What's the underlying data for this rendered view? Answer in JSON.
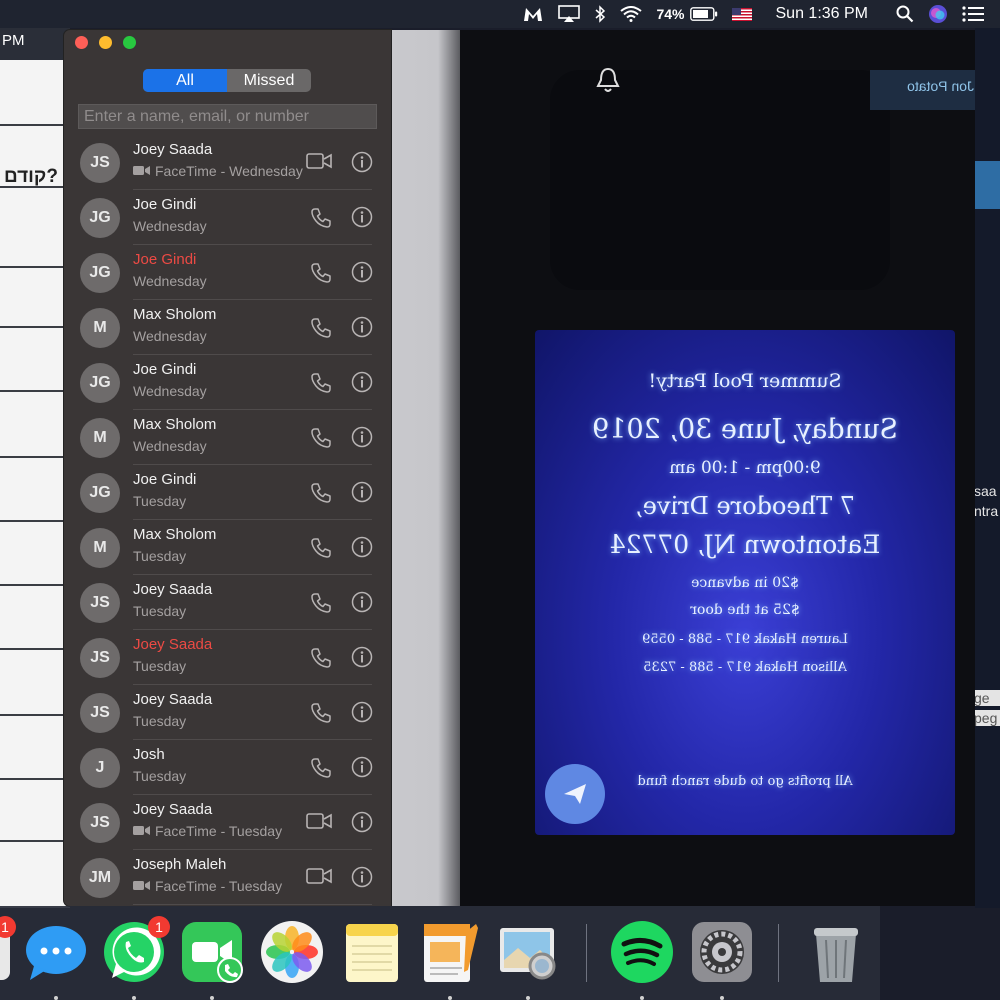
{
  "menubar": {
    "battery_percent": "74%",
    "clock": "Sun 1:36 PM",
    "icons": [
      "malwarebytes-icon",
      "airplay-icon",
      "bluetooth-icon",
      "wifi-icon",
      "battery-icon",
      "us-flag-icon",
      "spotlight-search-icon",
      "siri-icon",
      "notification-center-icon"
    ]
  },
  "background": {
    "left_window_time": "PM",
    "left_window_hebrew": "קודם?",
    "right_text_1": "saa",
    "right_text_2": "ntra",
    "right_text_3": "ge",
    "right_text_4": "peg"
  },
  "video": {
    "top_right_label": "Jon Potato",
    "card_lines": [
      "Summer Pool Party!",
      "Sunday, June 30, 2019",
      "9:00pm - 1:00 am",
      "7 Theodore Drive,",
      "Eatontown NJ, 07724",
      "$20 in advance",
      "$25 at the door",
      "Lauren Hakak 917 - 588 - 0559",
      "Allison Hakak 917 - 588 - 7235",
      "All profits go to dude ranch fund"
    ]
  },
  "facetime": {
    "tabs": [
      {
        "label": "All",
        "active": true
      },
      {
        "label": "Missed",
        "active": false
      }
    ],
    "search_placeholder": "Enter a name, email, or number",
    "calls": [
      {
        "initials": "JS",
        "name": "Joey Saada",
        "detail": "FaceTime - Wednesday",
        "type": "video",
        "missed": false
      },
      {
        "initials": "JG",
        "name": "Joe Gindi",
        "detail": "Wednesday",
        "type": "audio",
        "missed": false
      },
      {
        "initials": "JG",
        "name": "Joe Gindi",
        "detail": "Wednesday",
        "type": "audio",
        "missed": true
      },
      {
        "initials": "M",
        "name": "Max Sholom",
        "detail": "Wednesday",
        "type": "audio",
        "missed": false
      },
      {
        "initials": "JG",
        "name": "Joe Gindi",
        "detail": "Wednesday",
        "type": "audio",
        "missed": false
      },
      {
        "initials": "M",
        "name": "Max Sholom",
        "detail": "Wednesday",
        "type": "audio",
        "missed": false
      },
      {
        "initials": "JG",
        "name": "Joe Gindi",
        "detail": "Tuesday",
        "type": "audio",
        "missed": false
      },
      {
        "initials": "M",
        "name": "Max Sholom",
        "detail": "Tuesday",
        "type": "audio",
        "missed": false
      },
      {
        "initials": "JS",
        "name": "Joey Saada",
        "detail": "Tuesday",
        "type": "audio",
        "missed": false
      },
      {
        "initials": "JS",
        "name": "Joey Saada",
        "detail": "Tuesday",
        "type": "audio",
        "missed": true
      },
      {
        "initials": "JS",
        "name": "Joey Saada",
        "detail": "Tuesday",
        "type": "audio",
        "missed": false
      },
      {
        "initials": "J",
        "name": "Josh",
        "detail": "Tuesday",
        "type": "audio",
        "missed": false
      },
      {
        "initials": "JS",
        "name": "Joey Saada",
        "detail": "FaceTime - Tuesday",
        "type": "video",
        "missed": false
      },
      {
        "initials": "JM",
        "name": "Joseph Maleh",
        "detail": "FaceTime - Tuesday",
        "type": "video",
        "missed": false
      }
    ]
  },
  "dock": {
    "apps": [
      {
        "name": "partial-app",
        "badge": "1"
      },
      {
        "name": "messages",
        "badge": ""
      },
      {
        "name": "whatsapp",
        "badge": "1"
      },
      {
        "name": "facetime",
        "badge": ""
      },
      {
        "name": "photos",
        "badge": ""
      },
      {
        "name": "notes",
        "badge": ""
      },
      {
        "name": "pages",
        "badge": ""
      },
      {
        "name": "preview",
        "badge": ""
      },
      {
        "name": "spotify",
        "badge": ""
      },
      {
        "name": "system-preferences",
        "badge": ""
      },
      {
        "name": "trash",
        "badge": ""
      }
    ]
  },
  "colors": {
    "accent_blue": "#1b72e8",
    "missed_red": "#ec4a44",
    "badge_red": "#f23a31"
  }
}
